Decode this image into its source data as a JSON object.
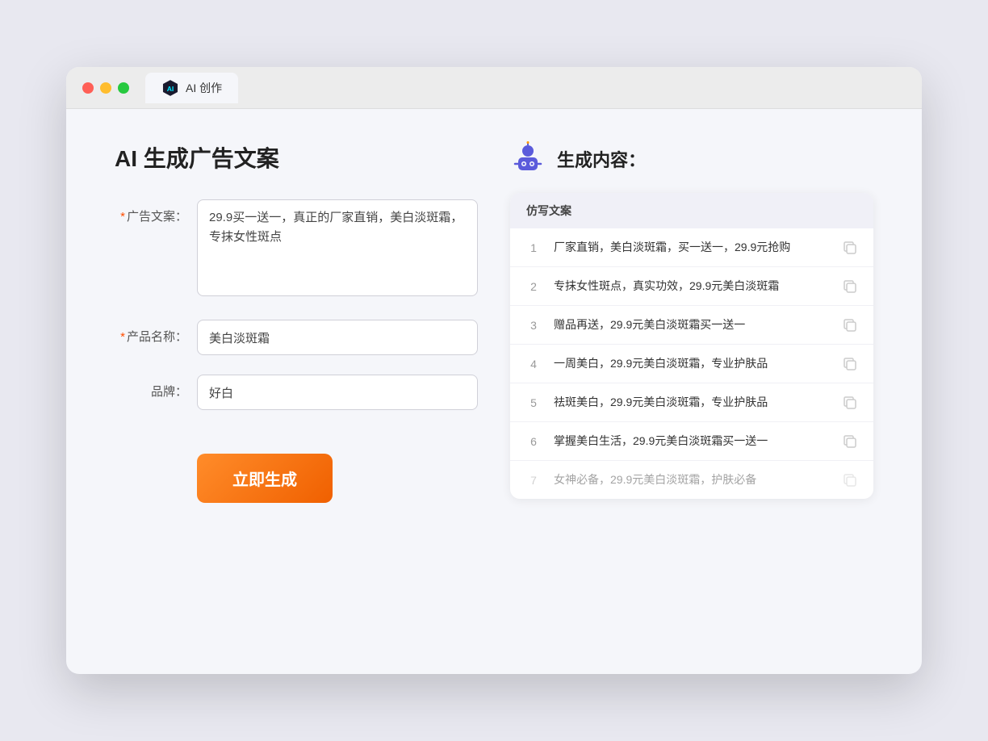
{
  "tab": {
    "title": "AI 创作"
  },
  "left": {
    "page_title": "AI 生成广告文案",
    "fields": [
      {
        "id": "ad_copy",
        "label": "广告文案：",
        "required": true,
        "type": "textarea",
        "value": "29.9买一送一，真正的厂家直销，美白淡斑霜，专抹女性斑点"
      },
      {
        "id": "product_name",
        "label": "产品名称：",
        "required": true,
        "type": "input",
        "value": "美白淡斑霜"
      },
      {
        "id": "brand",
        "label": "品牌：",
        "required": false,
        "type": "input",
        "value": "好白"
      }
    ],
    "generate_btn_label": "立即生成"
  },
  "right": {
    "title": "生成内容：",
    "column_header": "仿写文案",
    "results": [
      {
        "num": "1",
        "text": "厂家直销，美白淡斑霜，买一送一，29.9元抢购",
        "faded": false
      },
      {
        "num": "2",
        "text": "专抹女性斑点，真实功效，29.9元美白淡斑霜",
        "faded": false
      },
      {
        "num": "3",
        "text": "赠品再送，29.9元美白淡斑霜买一送一",
        "faded": false
      },
      {
        "num": "4",
        "text": "一周美白，29.9元美白淡斑霜，专业护肤品",
        "faded": false
      },
      {
        "num": "5",
        "text": "祛斑美白，29.9元美白淡斑霜，专业护肤品",
        "faded": false
      },
      {
        "num": "6",
        "text": "掌握美白生活，29.9元美白淡斑霜买一送一",
        "faded": false
      },
      {
        "num": "7",
        "text": "女神必备，29.9元美白淡斑霜，护肤必备",
        "faded": true
      }
    ]
  }
}
